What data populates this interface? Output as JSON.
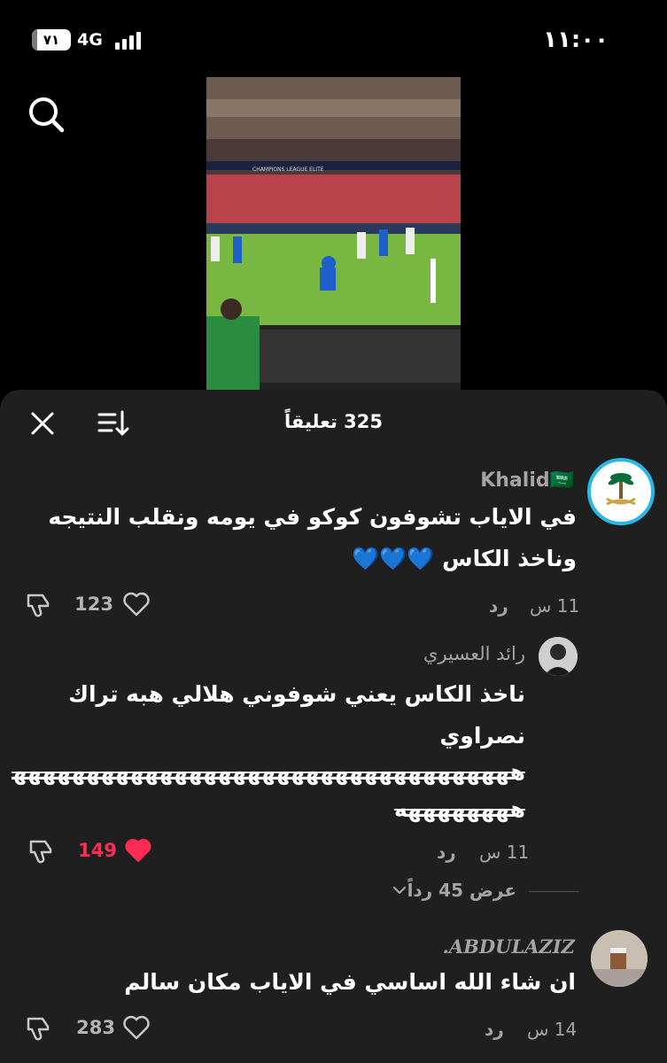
{
  "status_bar": {
    "battery": "٧١",
    "network": "4G",
    "time": "١١:٠٠"
  },
  "icons": {
    "search": "search-icon",
    "close": "close-icon",
    "sort": "sort-icon",
    "like": "heart-outline-icon",
    "liked": "heart-filled-icon",
    "dislike": "thumbs-down-icon"
  },
  "video": {
    "banner_text": "CHAMPIONS LEAGUE ELITE"
  },
  "sheet": {
    "title": "325 تعليقاً"
  },
  "comments": [
    {
      "username": "Khalid🇸🇦",
      "text": "في الاياب تشوفون كوكو في يومه ونقلب النتيجه وناخذ الكاس 💙💙💙",
      "time": "11 س",
      "reply_label": "رد",
      "likes": "123",
      "liked": false
    },
    {
      "username": "رائد العسيري",
      "text_line1": "ناخذ الكاس يعني شوفوني هلالي هبه تراك نصراوي",
      "text_line2": "هههههههههههههههههههههههههههههههههههههه",
      "text_line3": "ههههههههه",
      "time": "11 س",
      "reply_label": "رد",
      "likes": "149",
      "liked": true,
      "view_replies": "عرض 45 رداً"
    },
    {
      "username": "ABDULAZIZ.",
      "text": "ان شاء الله اساسي في الاياب مكان سالم",
      "time": "14 س",
      "reply_label": "رد",
      "likes": "283",
      "liked": false
    }
  ],
  "colors": {
    "sheet_bg": "#1f1f1f",
    "liked_red": "#fe2c55",
    "muted": "#a4a4a4",
    "avatar_ring": "#25b8e8",
    "saudi_green": "#0a6b3b"
  }
}
